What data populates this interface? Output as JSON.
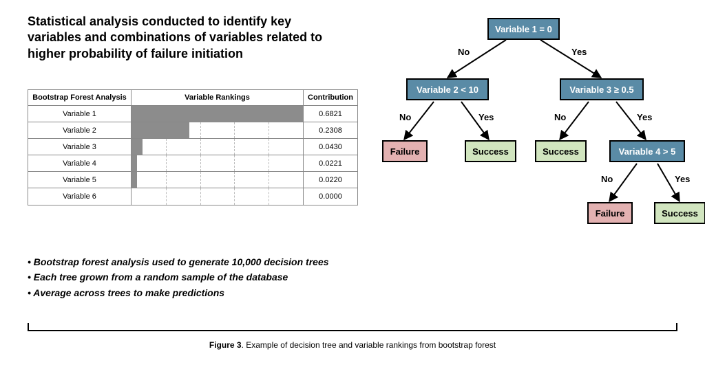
{
  "title": "Statistical analysis conducted to identify key variables and combinations of variables related to higher probability of failure initiation",
  "table": {
    "headers": {
      "col_a": "Bootstrap Forest Analysis",
      "col_b": "Variable Rankings",
      "col_c": "Contribution"
    },
    "rows": [
      {
        "name": "Variable 1",
        "contribution": "0.6821"
      },
      {
        "name": "Variable 2",
        "contribution": "0.2308"
      },
      {
        "name": "Variable 3",
        "contribution": "0.0430"
      },
      {
        "name": "Variable 4",
        "contribution": "0.0221"
      },
      {
        "name": "Variable 5",
        "contribution": "0.0220"
      },
      {
        "name": "Variable 6",
        "contribution": "0.0000"
      }
    ]
  },
  "bullets": {
    "b1": "Bootstrap forest analysis used to generate 10,000 decision trees",
    "b2": "Each tree grown from a random sample of the database",
    "b3": "Average across trees to make predictions"
  },
  "caption": {
    "lead": "Figure 3",
    "rest": ". Example of decision tree and variable rankings from bootstrap forest"
  },
  "tree": {
    "n1": "Variable 1 = 0",
    "n2": "Variable 2 < 10",
    "n3": "Variable 3 ≥ 0.5",
    "n4": "Failure",
    "n5": "Success",
    "n6": "Success",
    "n7": "Variable 4 > 5",
    "n8": "Failure",
    "n9": "Success",
    "labels": {
      "no": "No",
      "yes": "Yes"
    }
  },
  "chart_data": {
    "type": "bar",
    "title": "Variable Rankings",
    "categories": [
      "Variable 1",
      "Variable 2",
      "Variable 3",
      "Variable 4",
      "Variable 5",
      "Variable 6"
    ],
    "values": [
      0.6821,
      0.2308,
      0.043,
      0.0221,
      0.022,
      0.0
    ],
    "xlabel": "Contribution",
    "ylabel": "",
    "xlim": [
      0,
      0.7
    ]
  }
}
